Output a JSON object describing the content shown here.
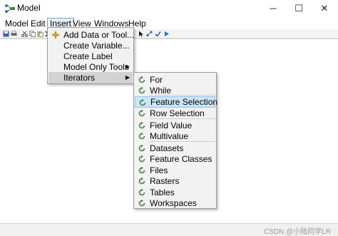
{
  "window": {
    "title": "Model",
    "controls": {
      "minimize": "─",
      "maximize": "☐",
      "close": "✕"
    }
  },
  "menubar": {
    "items": [
      "Model",
      "Edit",
      "Insert",
      "View",
      "Windows",
      "Help"
    ],
    "active": "Insert"
  },
  "toolbar": {
    "icons": [
      "save-icon",
      "print-icon",
      "cut-icon",
      "copy-icon",
      "paste-icon",
      "delete-icon",
      "add-data-icon",
      "select-pointer-icon",
      "connect-icon",
      "validate-icon",
      "run-icon"
    ]
  },
  "insert_menu": {
    "items": [
      {
        "label": "Add Data or Tool...",
        "icon": "add-data-icon"
      },
      {
        "label": "Create Variable..."
      },
      {
        "label": "Create Label"
      },
      {
        "label": "Model Only Tools",
        "submenu": true
      },
      {
        "label": "Iterators",
        "submenu": true,
        "highlighted": true
      }
    ],
    "submenu_arrow": "▶"
  },
  "iterators_menu": {
    "items": [
      "For",
      "While",
      "Feature Selection",
      "Row Selection",
      "Field Value",
      "Multivalue",
      "Datasets",
      "Feature Classes",
      "Files",
      "Rasters",
      "Tables",
      "Workspaces"
    ],
    "selected": "Feature Selection",
    "icon": "iterator-icon"
  },
  "statusbar": {
    "watermark": "CSDN @小陆同学LR"
  },
  "colors": {
    "menu_bg": "#f2f2f2",
    "highlight_blue": "#cce4f7",
    "iterator_icon": "#3a8a3a",
    "toolbar_bg": "#f3f3f3"
  }
}
